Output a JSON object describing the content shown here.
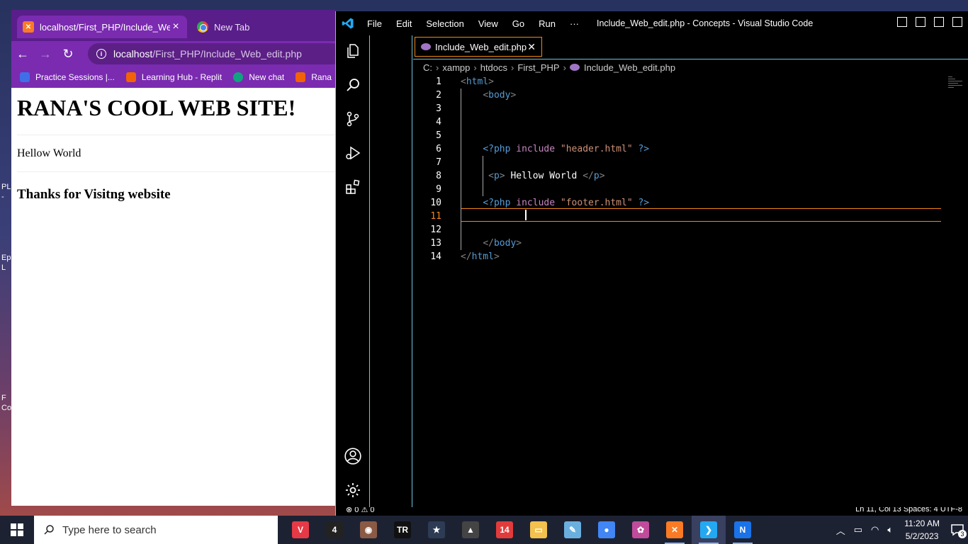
{
  "chrome": {
    "active_tab": {
      "title": "localhost/First_PHP/Include_Web_edit.php"
    },
    "new_tab": {
      "title": "New Tab"
    },
    "url": {
      "host": "localhost",
      "path": "/First_PHP/Include_Web_edit.php"
    },
    "bookmarks": [
      "Practice Sessions |...",
      "Learning Hub - Replit",
      "New chat",
      "Rana"
    ],
    "page": {
      "heading": "RANA'S COOL WEB SITE!",
      "paragraph": "Hellow World",
      "footer": "Thanks for Visitng website"
    }
  },
  "desktop": {
    "fragments": [
      "PL",
      "-",
      "Ep",
      "L",
      "F",
      "Co"
    ]
  },
  "vscode": {
    "menu": [
      "File",
      "Edit",
      "Selection",
      "View",
      "Go",
      "Run",
      "···"
    ],
    "window_title": "Include_Web_edit.php - Concepts - Visual Studio Code",
    "tab_label": "Include_Web_edit.php",
    "breadcrumb": [
      "C:",
      "xampp",
      "htdocs",
      "First_PHP",
      "Include_Web_edit.php"
    ],
    "line_numbers": [
      "1",
      "2",
      "3",
      "4",
      "5",
      "6",
      "7",
      "8",
      "9",
      "10",
      "11",
      "12",
      "13",
      "14"
    ],
    "code": {
      "l1_open": "<",
      "l1_tag": "html",
      "l1_close": ">",
      "l2_open": "<",
      "l2_tag": "body",
      "l2_close": ">",
      "l6_php": "<?php",
      "l6_kw": "include",
      "l6_str": "\"header.html\"",
      "l6_end": "?>",
      "l8_open": "<",
      "l8_tag": "p",
      "l8_close": ">",
      "l8_text": " Hellow World ",
      "l8_copen": "</",
      "l8_ctag": "p",
      "l8_cclose": ">",
      "l10_php": "<?php",
      "l10_kw": "include",
      "l10_str": "\"footer.html\"",
      "l10_end": "?>",
      "l13_open": "</",
      "l13_tag": "body",
      "l13_close": ">",
      "l14_open": "</",
      "l14_tag": "html",
      "l14_close": ">"
    },
    "status_left": "⊗ 0 ⚠ 0",
    "status_right": "Ln 11, Col 13    Spaces: 4    UTF-8"
  },
  "taskbar": {
    "search_placeholder": "Type here to search",
    "apps": [
      {
        "name": "valorant",
        "glyph": "V",
        "color": "#e63946"
      },
      {
        "name": "game-4",
        "glyph": "4",
        "color": "#222222"
      },
      {
        "name": "game-avatar",
        "glyph": "◉",
        "color": "#8a5a44"
      },
      {
        "name": "tomb-raider",
        "glyph": "TR",
        "color": "#111111"
      },
      {
        "name": "game-star",
        "glyph": "★",
        "color": "#2d3b55"
      },
      {
        "name": "game-tiger",
        "glyph": "▲",
        "color": "#444444"
      },
      {
        "name": "game-14",
        "glyph": "14",
        "color": "#e23b3b"
      },
      {
        "name": "file-explorer",
        "glyph": "▭",
        "color": "#f2c14e"
      },
      {
        "name": "notes",
        "glyph": "✎",
        "color": "#6ab0de"
      },
      {
        "name": "chrome",
        "glyph": "●",
        "color": "#4285f4"
      },
      {
        "name": "paint",
        "glyph": "✿",
        "color": "#c04b9a"
      },
      {
        "name": "xampp",
        "glyph": "✕",
        "color": "#fb7a24"
      },
      {
        "name": "vscode",
        "glyph": "❯",
        "color": "#23a9f2"
      },
      {
        "name": "chrome-profile",
        "glyph": "N",
        "color": "#1a73e8"
      }
    ],
    "time": "11:20 AM",
    "date": "5/2/2023",
    "notification_count": "3"
  }
}
